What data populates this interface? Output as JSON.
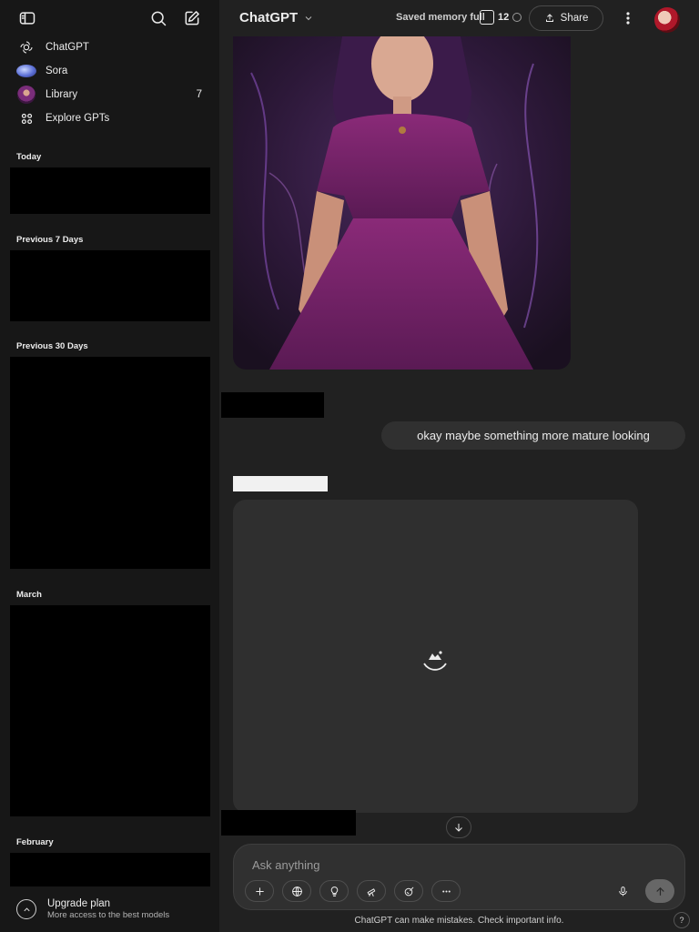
{
  "sidebar": {
    "items": [
      {
        "label": "ChatGPT",
        "icon": "openai-logo-icon"
      },
      {
        "label": "Sora",
        "icon": "sora-icon"
      },
      {
        "label": "Library",
        "icon": "library-thumbnail-icon",
        "count": "7"
      },
      {
        "label": "Explore GPTs",
        "icon": "grid-icon"
      }
    ],
    "sections": {
      "today": "Today",
      "prev7": "Previous 7 Days",
      "prev30": "Previous 30 Days",
      "march": "March",
      "february": "February"
    },
    "upgrade": {
      "title": "Upgrade plan",
      "subtitle": "More access to the best models"
    }
  },
  "header": {
    "model": "ChatGPT",
    "memory": "Saved memory full",
    "memory_suffix": "12",
    "share_label": "Share"
  },
  "chat": {
    "user_message": "okay maybe something more mature looking"
  },
  "composer": {
    "placeholder": "Ask anything"
  },
  "footer": {
    "disclaimer": "ChatGPT can make mistakes. Check important info.",
    "help": "?"
  },
  "colors": {
    "background": "#212121",
    "sidebar": "#171717",
    "bubble": "#303030",
    "placeholder_card": "#2f2f2f"
  }
}
